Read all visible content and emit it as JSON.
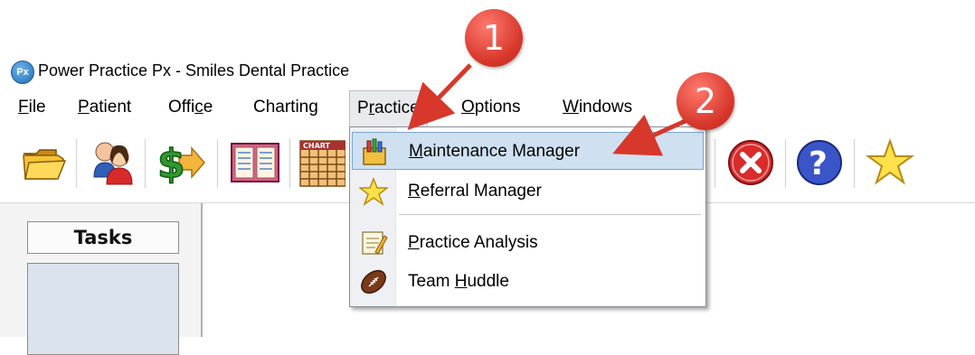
{
  "window": {
    "title": "Power Practice Px - Smiles Dental Practice",
    "logo_text": "Px"
  },
  "menubar": {
    "items": [
      {
        "pre": "",
        "key": "F",
        "post": "ile"
      },
      {
        "pre": "",
        "key": "P",
        "post": "atient"
      },
      {
        "pre": "Offi",
        "key": "c",
        "post": "e"
      },
      {
        "pre": "Charting",
        "key": "",
        "post": ""
      },
      {
        "pre": "P",
        "key": "r",
        "post": "actice"
      },
      {
        "pre": "",
        "key": "O",
        "post": "ptions"
      },
      {
        "pre": "",
        "key": "W",
        "post": "indows"
      }
    ]
  },
  "toolbar": {
    "icons": [
      "open-folder-icon",
      "patients-icon",
      "money-transfer-icon",
      "appointment-book-icon",
      "chart-icon",
      "close-icon",
      "help-icon",
      "favorites-star-icon"
    ],
    "chart_icon_text": "CHART"
  },
  "left_pane": {
    "tasks_label": "Tasks"
  },
  "practice_menu": {
    "items": [
      {
        "pre": "",
        "key": "M",
        "post": "aintenance Manager",
        "icon": "maintenance-icon",
        "highlighted": true
      },
      {
        "pre": "",
        "key": "R",
        "post": "eferral Manager",
        "icon": "star-icon",
        "highlighted": false
      },
      {
        "pre": "",
        "key": "P",
        "post": "ractice Analysis",
        "icon": "analysis-icon",
        "highlighted": false
      },
      {
        "pre": "Team ",
        "key": "H",
        "post": "uddle",
        "icon": "football-icon",
        "highlighted": false
      }
    ]
  },
  "callouts": [
    {
      "label": "1"
    },
    {
      "label": "2"
    }
  ],
  "colors": {
    "callout": "#d8372b",
    "highlight": "#cfe0f1",
    "highlight_border": "#7ea5cf"
  }
}
